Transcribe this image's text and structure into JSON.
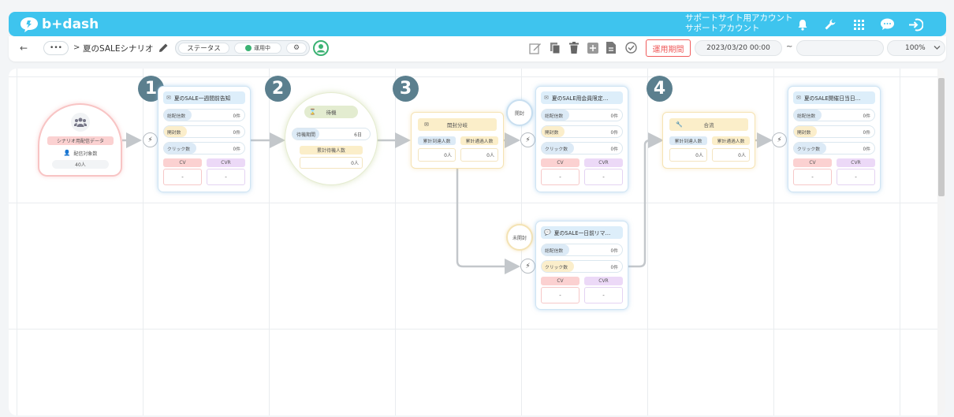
{
  "header": {
    "brand": "b+dash",
    "account_line1": "サポートサイト用アカウント",
    "account_line2": "サポートアカウント",
    "icons": [
      "bell-icon",
      "wrench-icon",
      "apps-grid-icon",
      "chat-bubble-icon",
      "logout-icon"
    ]
  },
  "toolbar": {
    "back": "←",
    "more": "•••",
    "breadcrumb_sep": ">",
    "scenario_name": "夏のSALEシナリオ",
    "status_label": "ステータス",
    "status_value": "運用中",
    "period_button": "運用期間",
    "start_datetime": "2023/03/20 00:00",
    "tilde": "~",
    "end_datetime": "",
    "zoom": "100%"
  },
  "badges": [
    "1",
    "2",
    "3",
    "4"
  ],
  "source": {
    "title": "シナリオ用配信データ",
    "label": "配信対象数",
    "value": "40人"
  },
  "cards": [
    {
      "title": "夏のSALE一週間前告知",
      "metrics": [
        {
          "label": "総配信数",
          "value": "0件",
          "style": "b"
        },
        {
          "label": "開封数",
          "value": "0件",
          "style": "y"
        },
        {
          "label": "クリック数",
          "value": "0件",
          "style": "b"
        }
      ],
      "cv": "CV",
      "cv_value": "-",
      "cvr": "CVR",
      "cvr_value": "-"
    },
    {
      "title": "夏のSALE用会員限定…",
      "metrics": [
        {
          "label": "総配信数",
          "value": "0件",
          "style": "b"
        },
        {
          "label": "開封数",
          "value": "0件",
          "style": "y"
        },
        {
          "label": "クリック数",
          "value": "0件",
          "style": "b"
        }
      ],
      "cv": "CV",
      "cv_value": "-",
      "cvr": "CVR",
      "cvr_value": "-"
    },
    {
      "title": "夏のSALE一日前リマ…",
      "metrics": [
        {
          "label": "総配信数",
          "value": "0件",
          "style": "b"
        },
        {
          "label": "クリック数",
          "value": "0件",
          "style": "y"
        }
      ],
      "cv": "CV",
      "cv_value": "-",
      "cvr": "CVR",
      "cvr_value": "-"
    },
    {
      "title": "夏のSALE開催日当日…",
      "metrics": [
        {
          "label": "総配信数",
          "value": "0件",
          "style": "b"
        },
        {
          "label": "開封数",
          "value": "0件",
          "style": "y"
        },
        {
          "label": "クリック数",
          "value": "0件",
          "style": "b"
        }
      ],
      "cv": "CV",
      "cv_value": "-",
      "cvr": "CVR",
      "cvr_value": "-"
    }
  ],
  "wait": {
    "title": "待機",
    "period_label": "待機期間",
    "period_value": "6日",
    "count_label": "累計待機人数",
    "count_value": "0人"
  },
  "branch": {
    "title": "開封分岐",
    "reach_label": "累計到達人数",
    "pass_label": "累計通過人数",
    "reach_value": "0人",
    "pass_value": "0人",
    "opened": "開封",
    "unopened": "未開封"
  },
  "merge": {
    "title": "合流",
    "reach_label": "累計到達人数",
    "pass_label": "累計通過人数",
    "reach_value": "0人",
    "pass_value": "0人"
  },
  "colors": {
    "header": "#3ec4ee",
    "badge": "#5b7f8e",
    "mail_card_border": "#cfe4f3",
    "branch_border": "#f6e3b3",
    "source_border": "#f8b9b9",
    "status_green": "#3bb273",
    "period_red": "#ef5b5b"
  }
}
